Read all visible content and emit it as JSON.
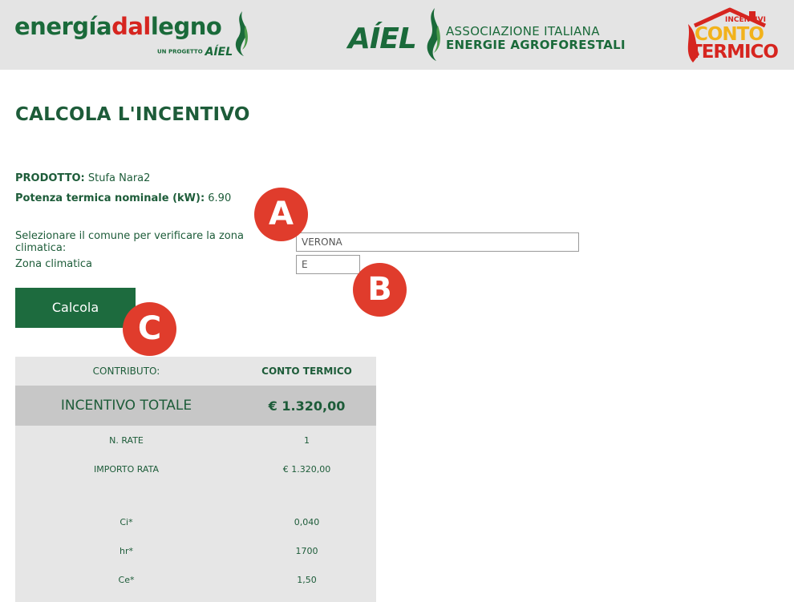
{
  "header": {
    "logo_edl": {
      "part1": "energía",
      "part2": "dal",
      "part3": "legno",
      "sub_small": "UN PROGETTO",
      "sub_brand": "AÍEL"
    },
    "logo_aiel": {
      "word": "AÍEL",
      "line1": "ASSOCIAZIONE ITALIANA",
      "line2": "ENERGIE AGROFORESTALI"
    },
    "logo_ct": {
      "top": "INCENTIVI",
      "mid": "CONTO",
      "bot": "TERMICO"
    }
  },
  "main": {
    "title": "CALCOLA L'INCENTIVO",
    "product_label": "PRODOTTO:",
    "product_value": "Stufa Nara2",
    "power_label": "Potenza termica nominale (kW):",
    "power_value": "6.90",
    "comune_label": "Selezionare il comune per verificare la zona climatica:",
    "comune_value": "VERONA",
    "zona_label": "Zona climatica",
    "zona_value": "E",
    "button_label": "Calcola"
  },
  "markers": {
    "a": "A",
    "b": "B",
    "c": "C"
  },
  "result": {
    "header_left": "CONTRIBUTO:",
    "header_right": "CONTO TERMICO",
    "total_left": "INCENTIVO TOTALE",
    "total_right": "€ 1.320,00",
    "rows": [
      {
        "label": "N. RATE",
        "value": "1"
      },
      {
        "label": "IMPORTO RATA",
        "value": "€ 1.320,00"
      },
      {
        "label": "Ci*",
        "value": "0,040"
      },
      {
        "label": "hr*",
        "value": "1700"
      },
      {
        "label": "Ce*",
        "value": "1,50"
      }
    ]
  },
  "colors": {
    "brand_green": "#1d6b3e",
    "brand_red": "#d6251f",
    "brand_yellow": "#f2b21b",
    "marker_red": "#e03c2c"
  }
}
